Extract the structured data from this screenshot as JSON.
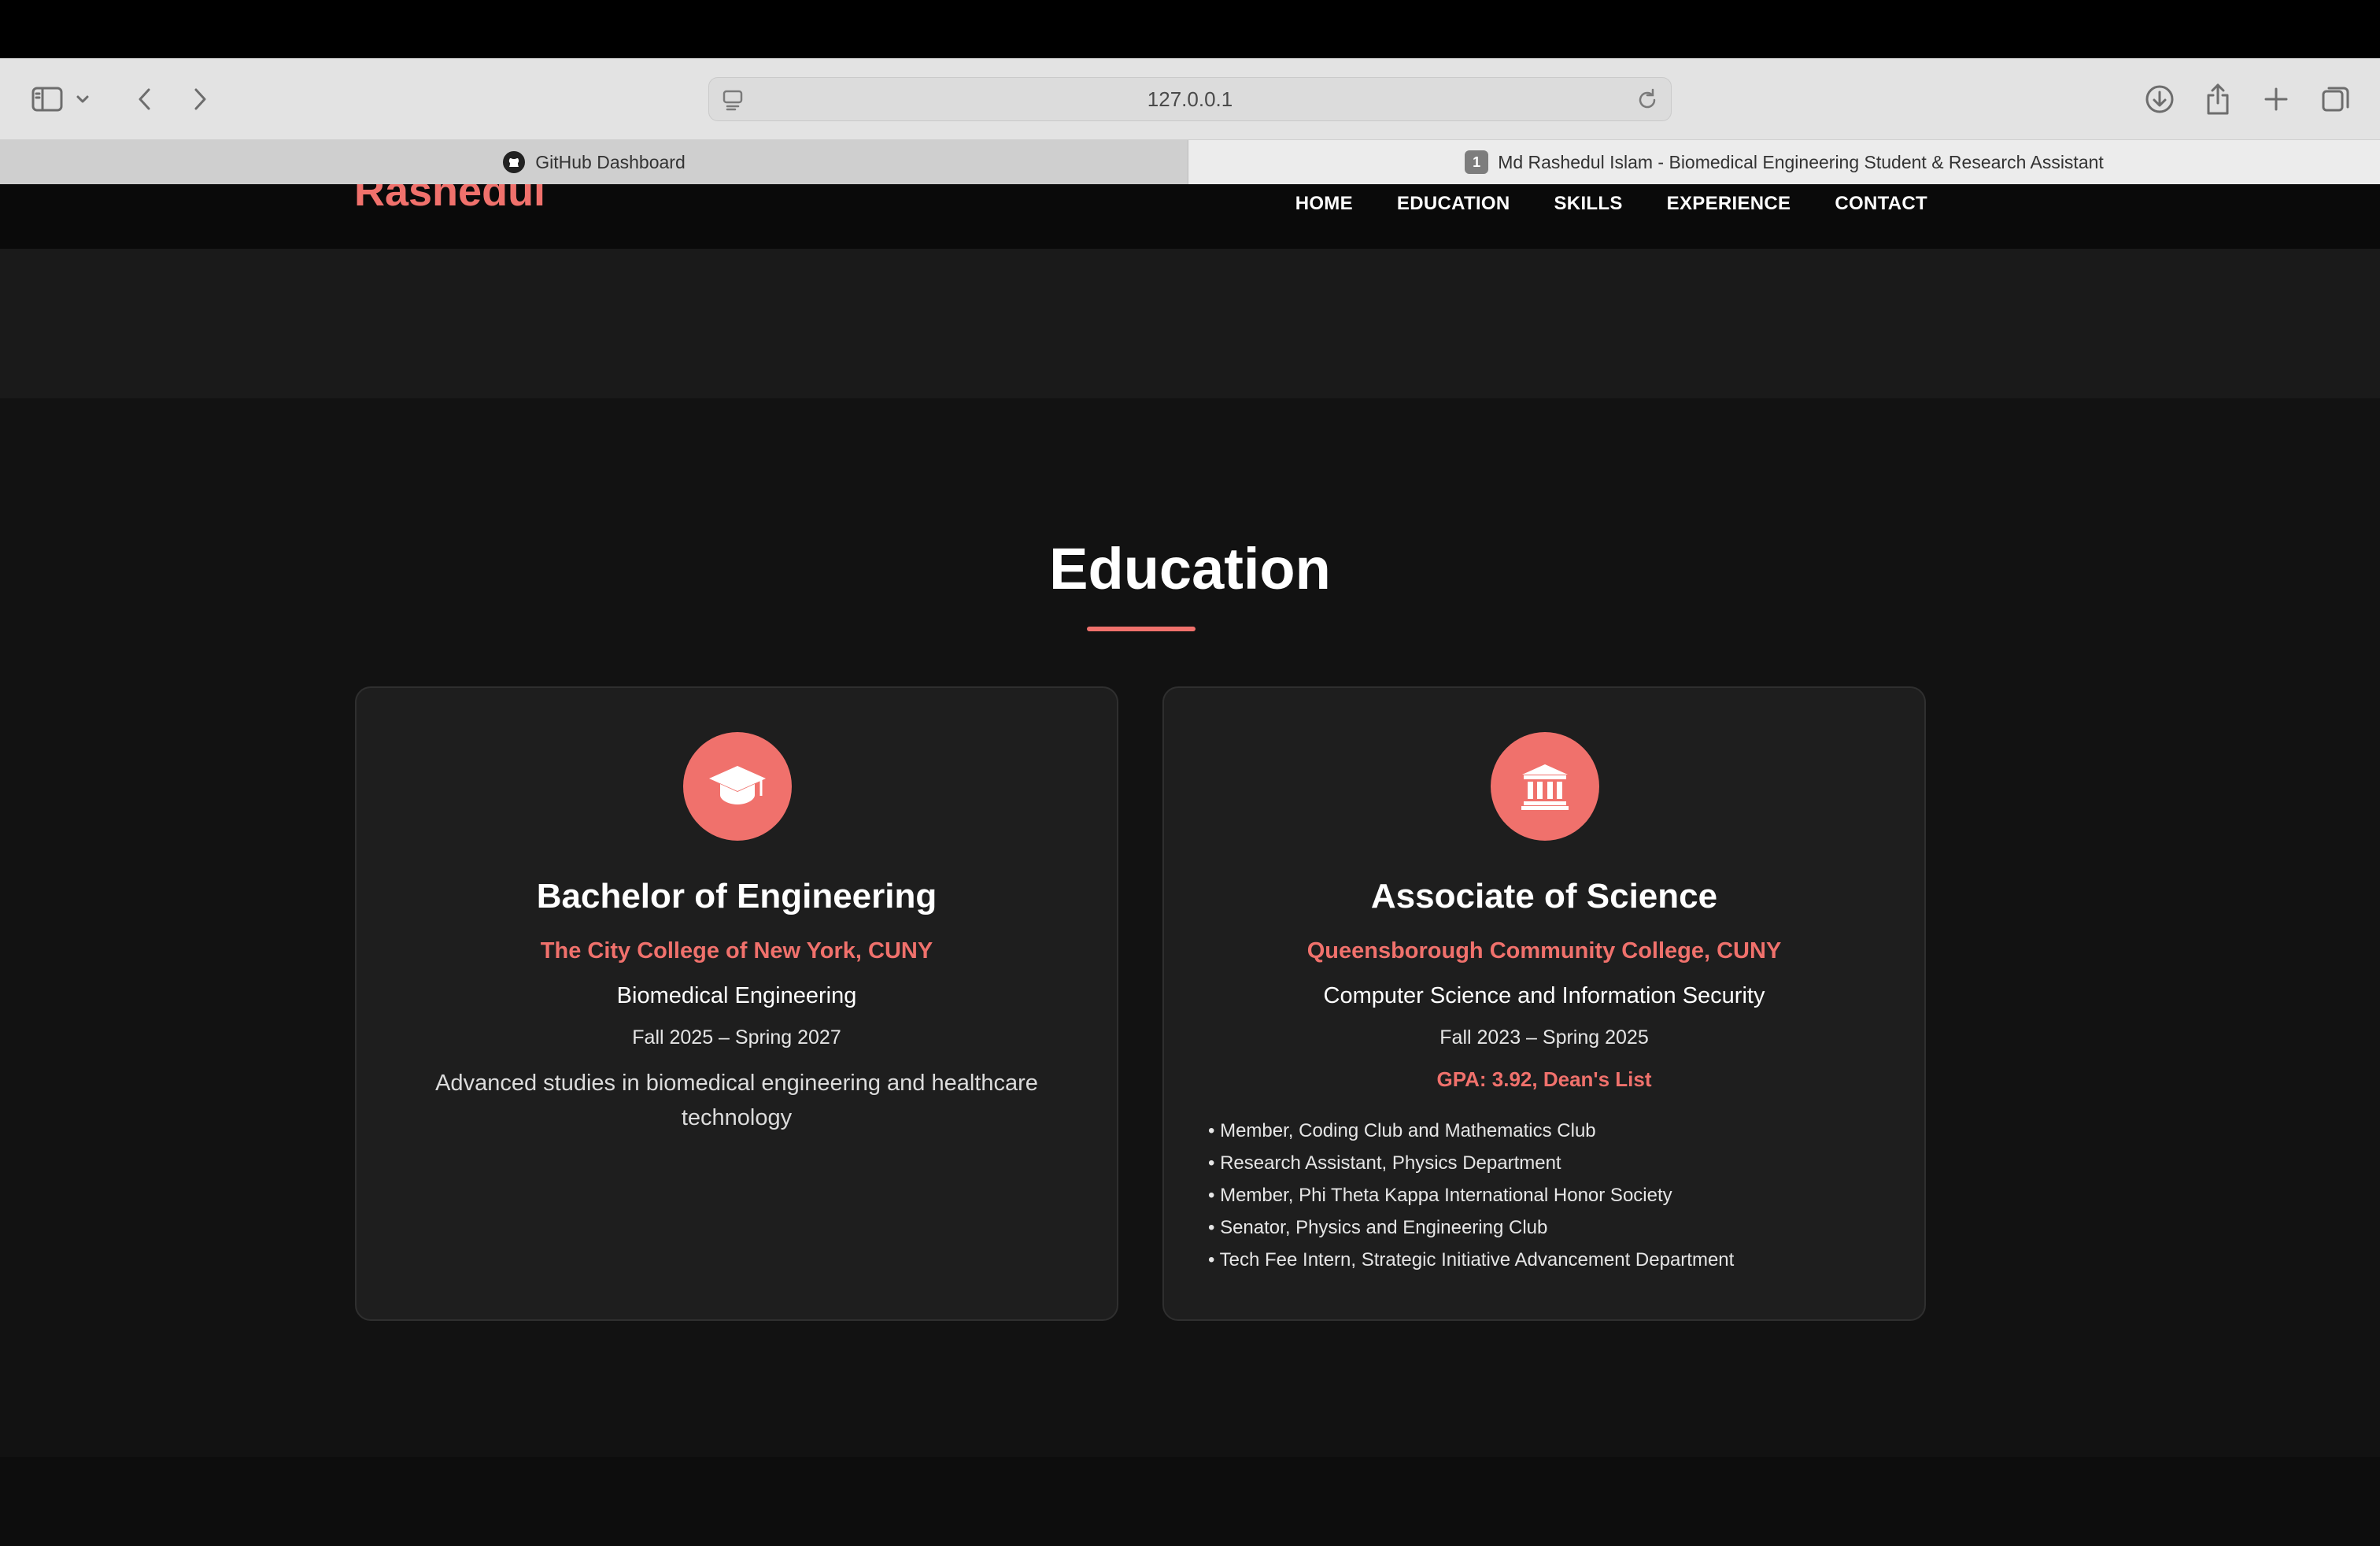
{
  "browser": {
    "url": "127.0.0.1",
    "tabs": [
      {
        "label": "GitHub Dashboard",
        "icon": "github-icon"
      },
      {
        "label": "Md Rashedul Islam - Biomedical Engineering Student & Research Assistant",
        "badge": "1"
      }
    ]
  },
  "site": {
    "logo": "Rashedul",
    "nav": [
      "HOME",
      "EDUCATION",
      "SKILLS",
      "EXPERIENCE",
      "CONTACT"
    ]
  },
  "education": {
    "title": "Education",
    "accent_color": "#f0716c",
    "cards": [
      {
        "icon": "graduation-cap-icon",
        "degree": "Bachelor of Engineering",
        "school": "The City College of New York, CUNY",
        "major": "Biomedical Engineering",
        "dates": "Fall 2025 – Spring 2027",
        "description": "Advanced studies in biomedical engineering and healthcare technology"
      },
      {
        "icon": "university-icon",
        "degree": "Associate of Science",
        "school": "Queensborough Community College, CUNY",
        "major": "Computer Science and Information Security",
        "dates": "Fall 2023 – Spring 2025",
        "gpa": "GPA: 3.92, Dean's List",
        "activities": [
          "Member, Coding Club and Mathematics Club",
          "Research Assistant, Physics Department",
          "Member, Phi Theta Kappa International Honor Society",
          "Senator, Physics and Engineering Club",
          "Tech Fee Intern, Strategic Initiative Advancement Department"
        ]
      }
    ]
  }
}
